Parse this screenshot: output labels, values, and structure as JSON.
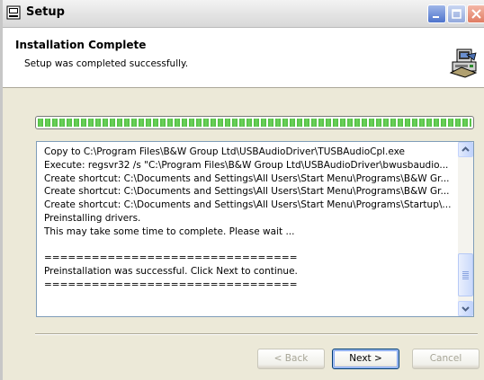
{
  "window": {
    "title": "Setup",
    "colors": {
      "title_bar": "#e6e6e6",
      "client_bg": "#ece9d8",
      "progress_fill": "#4dbc3f"
    }
  },
  "header": {
    "title": "Installation Complete",
    "subtitle": "Setup was completed successfully.",
    "icon": "installer-computer-icon"
  },
  "progress": {
    "percent": 100
  },
  "log": {
    "lines": [
      "Copy to C:\\Program Files\\B&W Group Ltd\\USBAudioDriver\\TUSBAudioCpl.exe",
      "Execute: regsvr32 /s \"C:\\Program Files\\B&W Group Ltd\\USBAudioDriver\\bwusbaudio...",
      "Create shortcut: C:\\Documents and Settings\\All Users\\Start Menu\\Programs\\B&W Gr...",
      "Create shortcut: C:\\Documents and Settings\\All Users\\Start Menu\\Programs\\B&W Gr...",
      "Create shortcut: C:\\Documents and Settings\\All Users\\Start Menu\\Programs\\Startup\\...",
      "Preinstalling drivers.",
      "This may take some time to complete. Please wait ...",
      "",
      "================================",
      "Preinstallation was successful. Click Next to continue.",
      "================================"
    ]
  },
  "buttons": {
    "back": "< Back",
    "next": "Next >",
    "cancel": "Cancel"
  }
}
